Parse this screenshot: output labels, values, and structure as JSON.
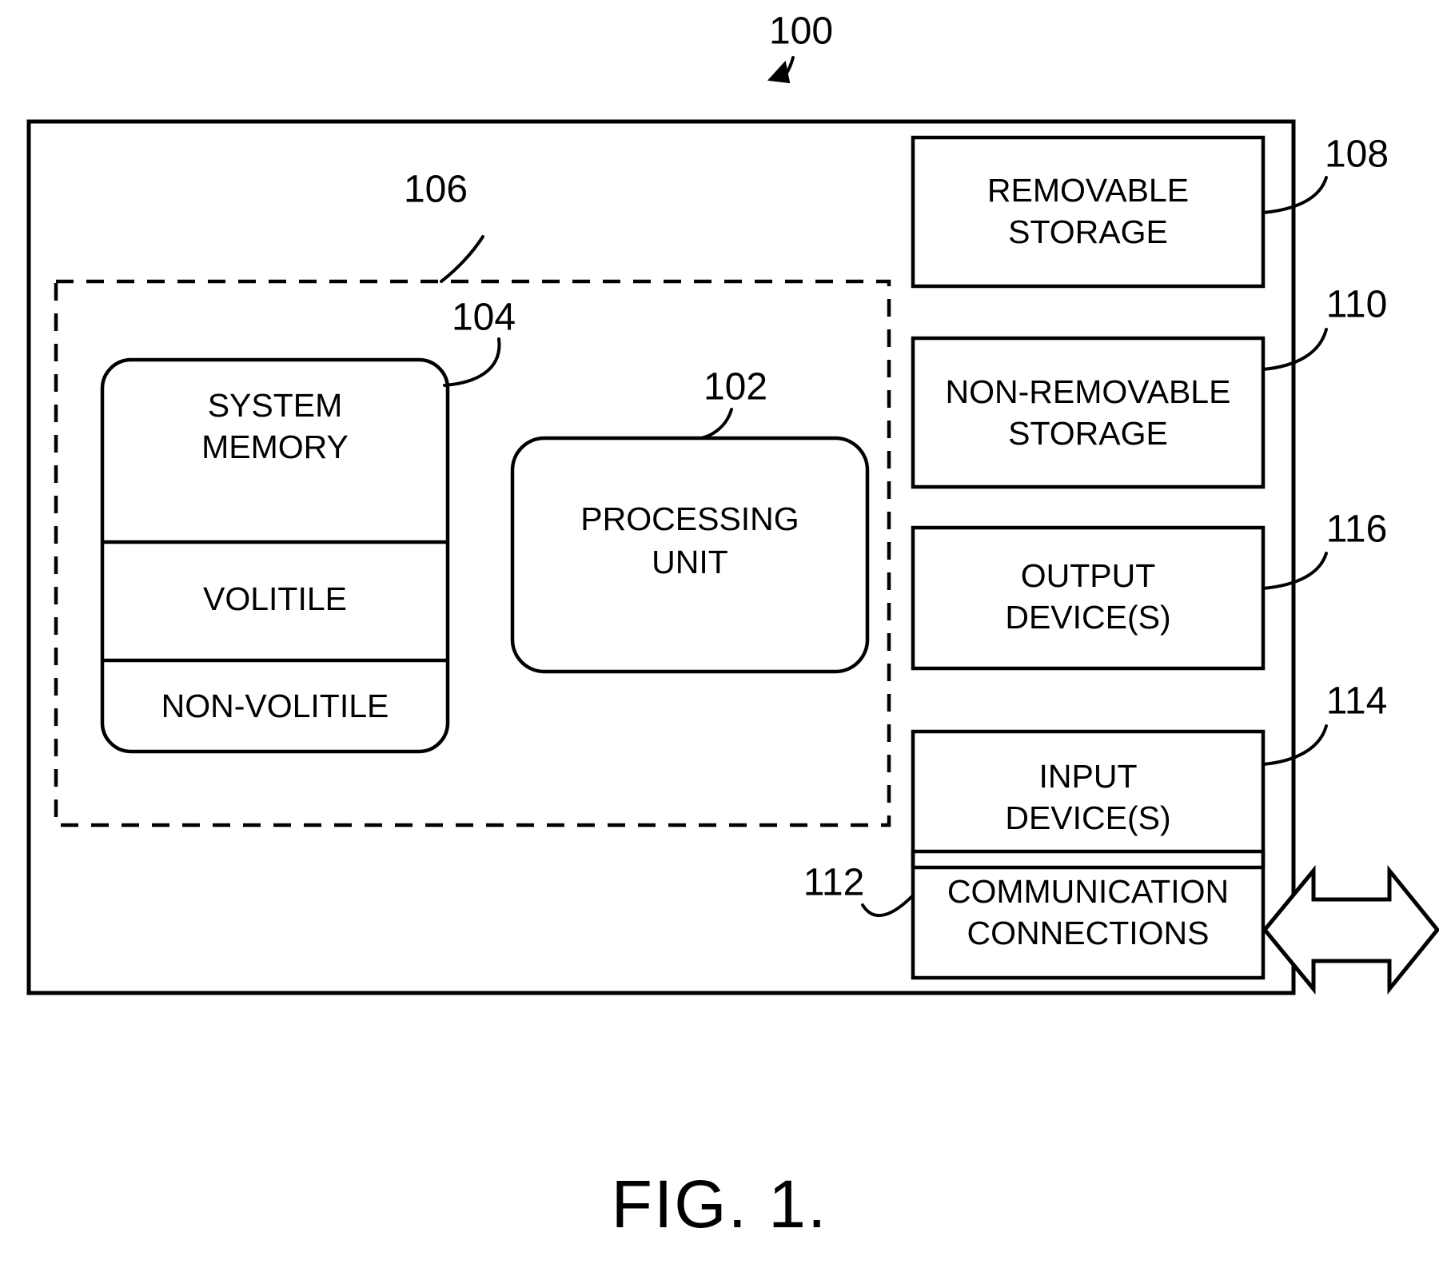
{
  "figure": {
    "caption": "FIG. 1.",
    "system_ref": "100"
  },
  "outer_device": {
    "name": "computing-device-boundary",
    "ref": "100"
  },
  "dashed_region": {
    "ref": "106",
    "name": "basic-configuration-region"
  },
  "memory_block": {
    "ref": "104",
    "sections": [
      {
        "label": "SYSTEM\nMEMORY",
        "line1": "SYSTEM",
        "line2": "MEMORY"
      },
      {
        "label": "VOLITILE",
        "line1": "VOLITILE",
        "line2": ""
      },
      {
        "label": "NON-VOLITILE",
        "line1": "NON-VOLITILE",
        "line2": ""
      }
    ]
  },
  "processing_unit": {
    "ref": "102",
    "line1": "PROCESSING",
    "line2": "UNIT"
  },
  "peripherals": [
    {
      "ref": "108",
      "line1": "REMOVABLE",
      "line2": "STORAGE"
    },
    {
      "ref": "110",
      "line1": "NON-REMOVABLE",
      "line2": "STORAGE"
    },
    {
      "ref": "116",
      "line1": "OUTPUT",
      "line2": "DEVICE(S)"
    },
    {
      "ref": "114",
      "line1": "INPUT",
      "line2": "DEVICE(S)"
    },
    {
      "ref": "112",
      "line1": "COMMUNICATION",
      "line2": "CONNECTIONS"
    }
  ],
  "colors": {
    "ink": "#000000",
    "paper": "#ffffff"
  }
}
